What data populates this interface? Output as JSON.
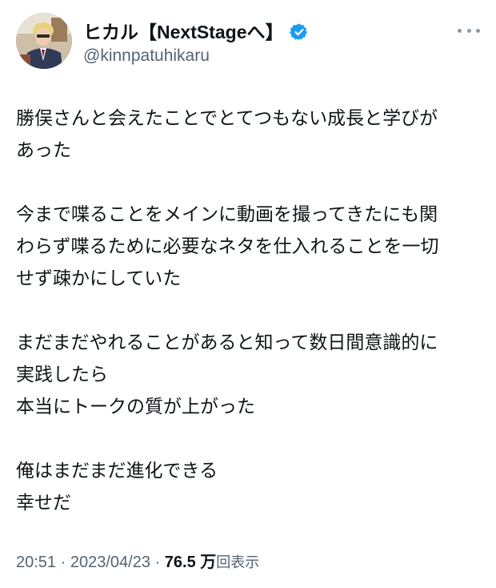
{
  "author": {
    "display_name": "ヒカル【NextStageへ】",
    "handle": "@kinnpatuhikaru",
    "verified": true,
    "avatar_icon": "avatar-photo",
    "verified_icon": "verified-badge-icon",
    "verified_color": "#1d9bf0"
  },
  "more_icon": "more-options-icon",
  "tweet": {
    "lines": [
      "勝俣さんと会えたことでとてつもない成長と学びが",
      "あった",
      "",
      "今まで喋ることをメインに動画を撮ってきたにも関",
      "わらず喋るために必要なネタを仕入れることを一切",
      "せず疎かにしていた",
      "",
      "まだまだやれることがあると知って数日間意識的に",
      "実践したら",
      "本当にトークの質が上がった",
      "",
      "俺はまだまだ進化できる",
      "幸せだ"
    ]
  },
  "meta": {
    "time": "20:51",
    "separator": "·",
    "date": "2023/04/23",
    "views_count": "76.5 万",
    "views_label": "回表示"
  },
  "colors": {
    "text_primary": "#0f1419",
    "text_secondary": "#536471",
    "background": "#ffffff"
  }
}
